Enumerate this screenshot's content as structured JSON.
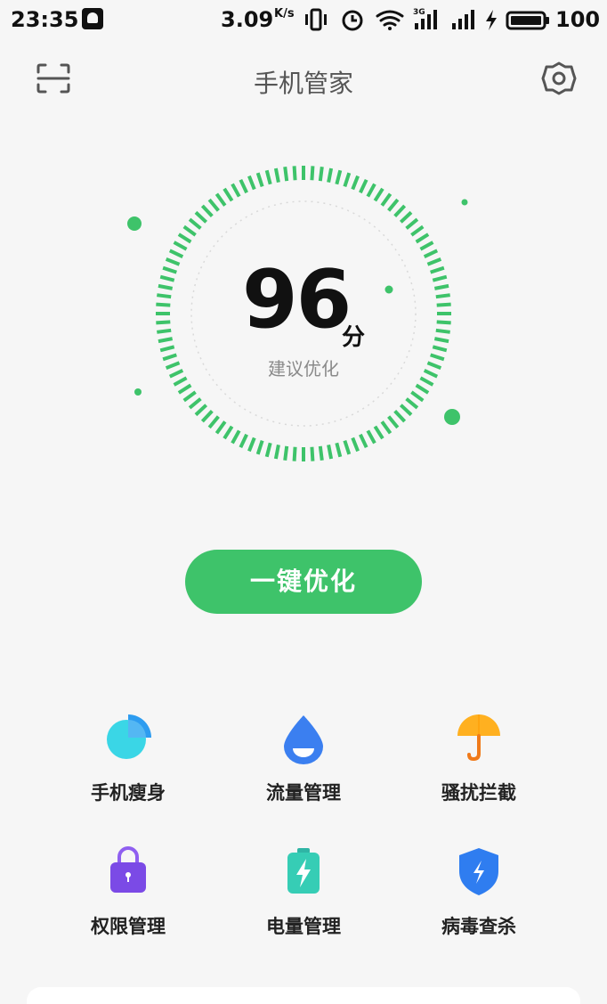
{
  "status_bar": {
    "time": "23:35",
    "speed": "3.09",
    "speed_unit": "K/s",
    "battery": "100"
  },
  "header": {
    "title": "手机管家"
  },
  "score": {
    "value": "96",
    "unit": "分",
    "description": "建议优化"
  },
  "optimize_button": {
    "label": "一键优化"
  },
  "tools": [
    {
      "label": "手机瘦身",
      "icon": "pie-chart-icon"
    },
    {
      "label": "流量管理",
      "icon": "water-drop-icon"
    },
    {
      "label": "骚扰拦截",
      "icon": "umbrella-icon"
    },
    {
      "label": "权限管理",
      "icon": "lock-bag-icon"
    },
    {
      "label": "电量管理",
      "icon": "battery-icon"
    },
    {
      "label": "病毒查杀",
      "icon": "shield-icon"
    }
  ],
  "colors": {
    "accent_green": "#3ec36a",
    "background": "#f6f6f6"
  }
}
